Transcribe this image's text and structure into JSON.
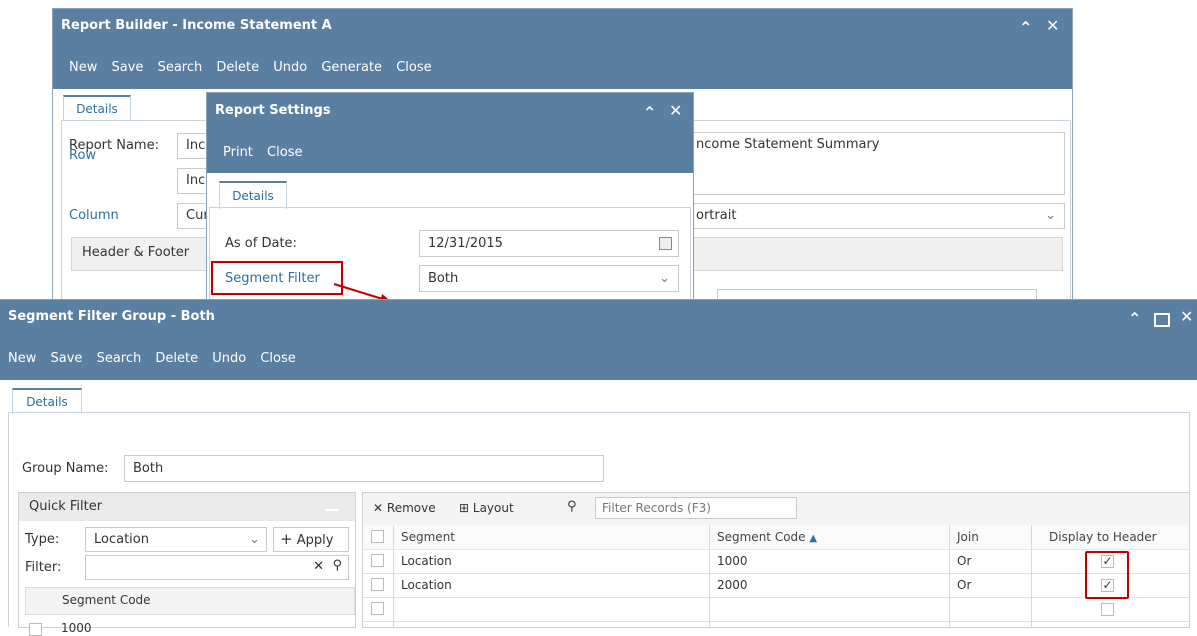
{
  "report_builder": {
    "title": "Report Builder - Income Statement A",
    "menu": [
      "New",
      "Save",
      "Search",
      "Delete",
      "Undo",
      "Generate",
      "Close"
    ],
    "tab": "Details",
    "report_name_label": "Report Name:",
    "report_name_value": "Inc",
    "row_label": "Row",
    "row_value": "Inc",
    "column_label": "Column",
    "column_value": "Cur",
    "description_value": "ncome Statement Summary",
    "orientation_value": "ortrait",
    "header_footer_label": "Header & Footer"
  },
  "report_settings": {
    "title": "Report Settings",
    "menu": [
      "Print",
      "Close"
    ],
    "tab": "Details",
    "as_of_date_label": "As of Date:",
    "as_of_date_value": "12/31/2015",
    "segment_filter_label": "Segment Filter",
    "segment_filter_value": "Both"
  },
  "segment_filter_group": {
    "title": "Segment Filter Group - Both",
    "menu": [
      "New",
      "Save",
      "Search",
      "Delete",
      "Undo",
      "Close"
    ],
    "tab": "Details",
    "group_name_label": "Group Name:",
    "group_name_value": "Both",
    "quick_filter": {
      "title": "Quick Filter",
      "type_label": "Type:",
      "type_value": "Location",
      "apply_label": "Apply",
      "filter_label": "Filter:",
      "column_header": "Segment Code",
      "rows": [
        "1000"
      ]
    },
    "grid": {
      "toolbar": {
        "remove": "Remove",
        "layout": "Layout",
        "filter_placeholder": "Filter Records (F3)"
      },
      "headers": {
        "segment": "Segment",
        "segment_code": "Segment Code",
        "join": "Join",
        "display": "Display to Header"
      },
      "rows": [
        {
          "segment": "Location",
          "segment_code": "1000",
          "join": "Or"
        },
        {
          "segment": "Location",
          "segment_code": "2000",
          "join": "Or"
        }
      ]
    }
  },
  "colors": {
    "titlebar": "#5b7fa0",
    "link": "#2e6ea6",
    "highlight": "#c00000"
  }
}
